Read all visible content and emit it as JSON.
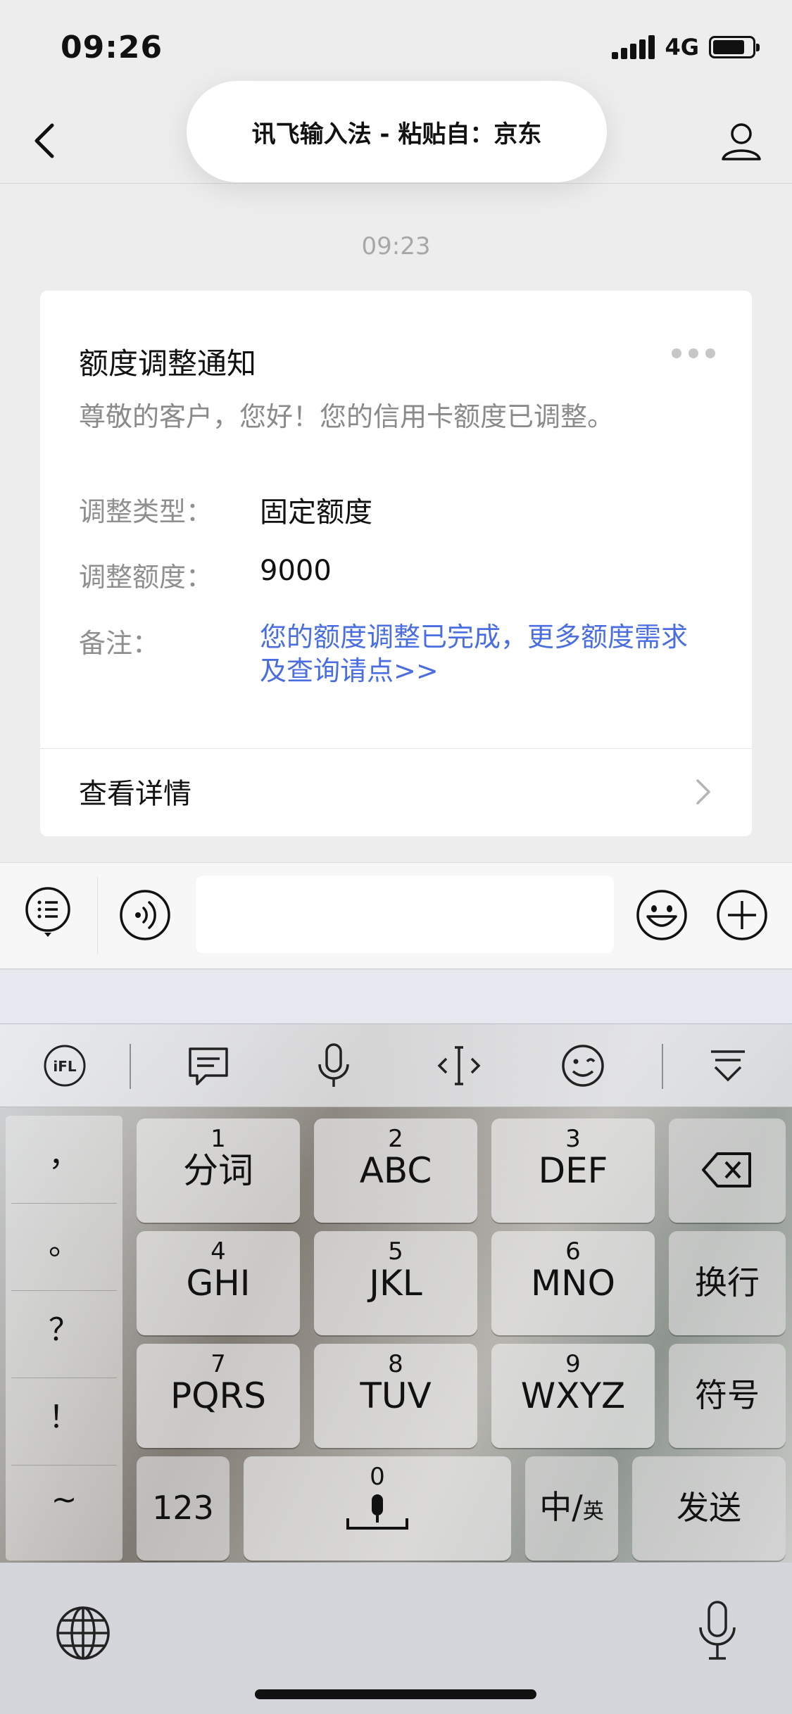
{
  "status_bar": {
    "time": "09:26",
    "network": "4G"
  },
  "header": {
    "toast": "讯飞输入法 - 粘贴自：京东"
  },
  "message_time": "09:23",
  "card": {
    "title": "额度调整通知",
    "subtitle": "尊敬的客户，您好！您的信用卡额度已调整。",
    "rows": [
      {
        "label": "调整类型：",
        "value": "固定额度"
      },
      {
        "label": "调整额度：",
        "value": "9000"
      },
      {
        "label": "备注：",
        "value": "您的额度调整已完成，更多额度需求及查询请点>>"
      }
    ],
    "detail": "查看详情"
  },
  "input_bar": {
    "text_value": ""
  },
  "keyboard": {
    "punctuation": [
      "，",
      "。",
      "？",
      "！",
      "~"
    ],
    "keys": [
      {
        "num": "1",
        "label": "分词"
      },
      {
        "num": "2",
        "label": "ABC"
      },
      {
        "num": "3",
        "label": "DEF"
      },
      {
        "num": "4",
        "label": "GHI"
      },
      {
        "num": "5",
        "label": "JKL"
      },
      {
        "num": "6",
        "label": "MNO"
      },
      {
        "num": "7",
        "label": "PQRS"
      },
      {
        "num": "8",
        "label": "TUV"
      },
      {
        "num": "9",
        "label": "WXYZ"
      }
    ],
    "newline": "换行",
    "symbols": "符号",
    "numbers": "123",
    "space_num": "0",
    "lang_main": "中/",
    "lang_sub": "英",
    "send": "发送"
  },
  "colors": {
    "link_blue": "#4a6ee0",
    "background": "#ededed"
  }
}
